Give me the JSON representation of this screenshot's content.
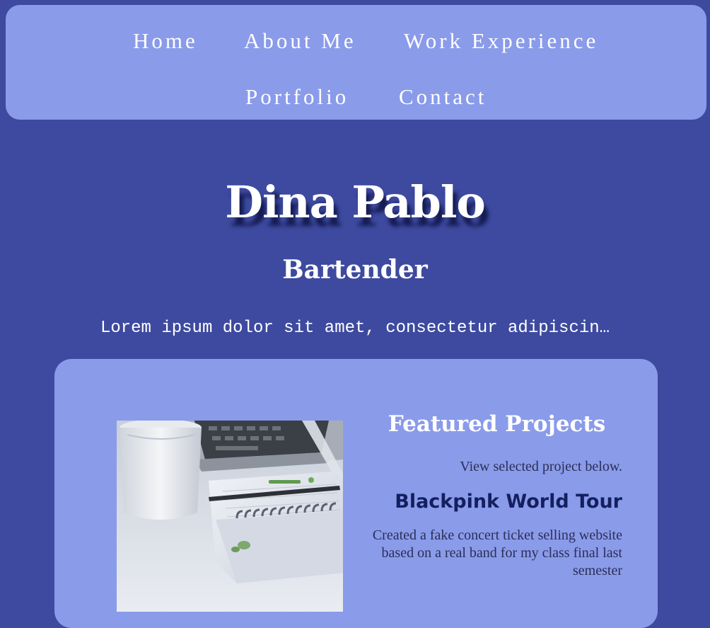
{
  "nav": {
    "links": [
      "Home",
      "About Me",
      "Work Experience",
      "Portfolio",
      "Contact"
    ]
  },
  "hero": {
    "name": "Dina Pablo",
    "role": "Bartender",
    "bio": "Lorem ipsum dolor sit amet, consectetur adipiscin…"
  },
  "featured": {
    "title": "Featured Projects",
    "subtitle": "View selected project below.",
    "project": {
      "title": "Blackpink World Tour",
      "description": "Created a fake concert ticket selling website based on a real band for my class final last semester"
    }
  },
  "colors": {
    "background": "#3d4a9f",
    "panel": "#8a9bea",
    "heading_text": "#ffffff",
    "project_title": "#14205e"
  }
}
